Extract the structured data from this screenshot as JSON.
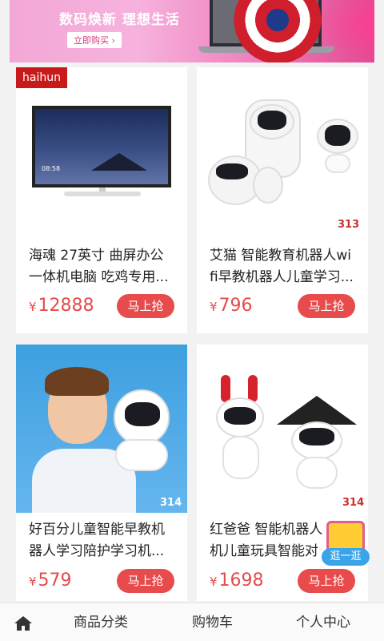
{
  "banner": {
    "title": "数码焕新  理想生活",
    "cta": "立即购买 ›"
  },
  "brand_tag": "haihun",
  "products": [
    {
      "name_line1": "海魂 27英寸 曲屏办公",
      "name_line2": "一体机电脑 吃鸡专用...",
      "price": "12888",
      "currency": "¥",
      "buy_label": "马上抢",
      "badge": "",
      "clock": "08:58"
    },
    {
      "name_line1": "艾猫 智能教育机器人wi",
      "name_line2": "fi早教机器人儿童学习...",
      "price": "796",
      "currency": "¥",
      "buy_label": "马上抢",
      "badge": "313"
    },
    {
      "name_line1": "好百分儿童智能早教机",
      "name_line2": "器人学习陪护学习机...",
      "price": "579",
      "currency": "¥",
      "buy_label": "马上抢",
      "badge": "314"
    },
    {
      "name_line1": "红爸爸 智能机器人",
      "name_line2": "机儿童玩具智能对",
      "price": "1698",
      "currency": "¥",
      "buy_label": "马上抢",
      "badge": "314"
    }
  ],
  "float_button": {
    "label": "逛一逛"
  },
  "nav": {
    "home_icon": "home-icon",
    "items": [
      {
        "label": "商品分类"
      },
      {
        "label": "购物车"
      },
      {
        "label": "个人中心"
      }
    ]
  },
  "colors": {
    "accent": "#e84b4b",
    "price": "#e54b4b",
    "brand_tag": "#c81a1a"
  }
}
